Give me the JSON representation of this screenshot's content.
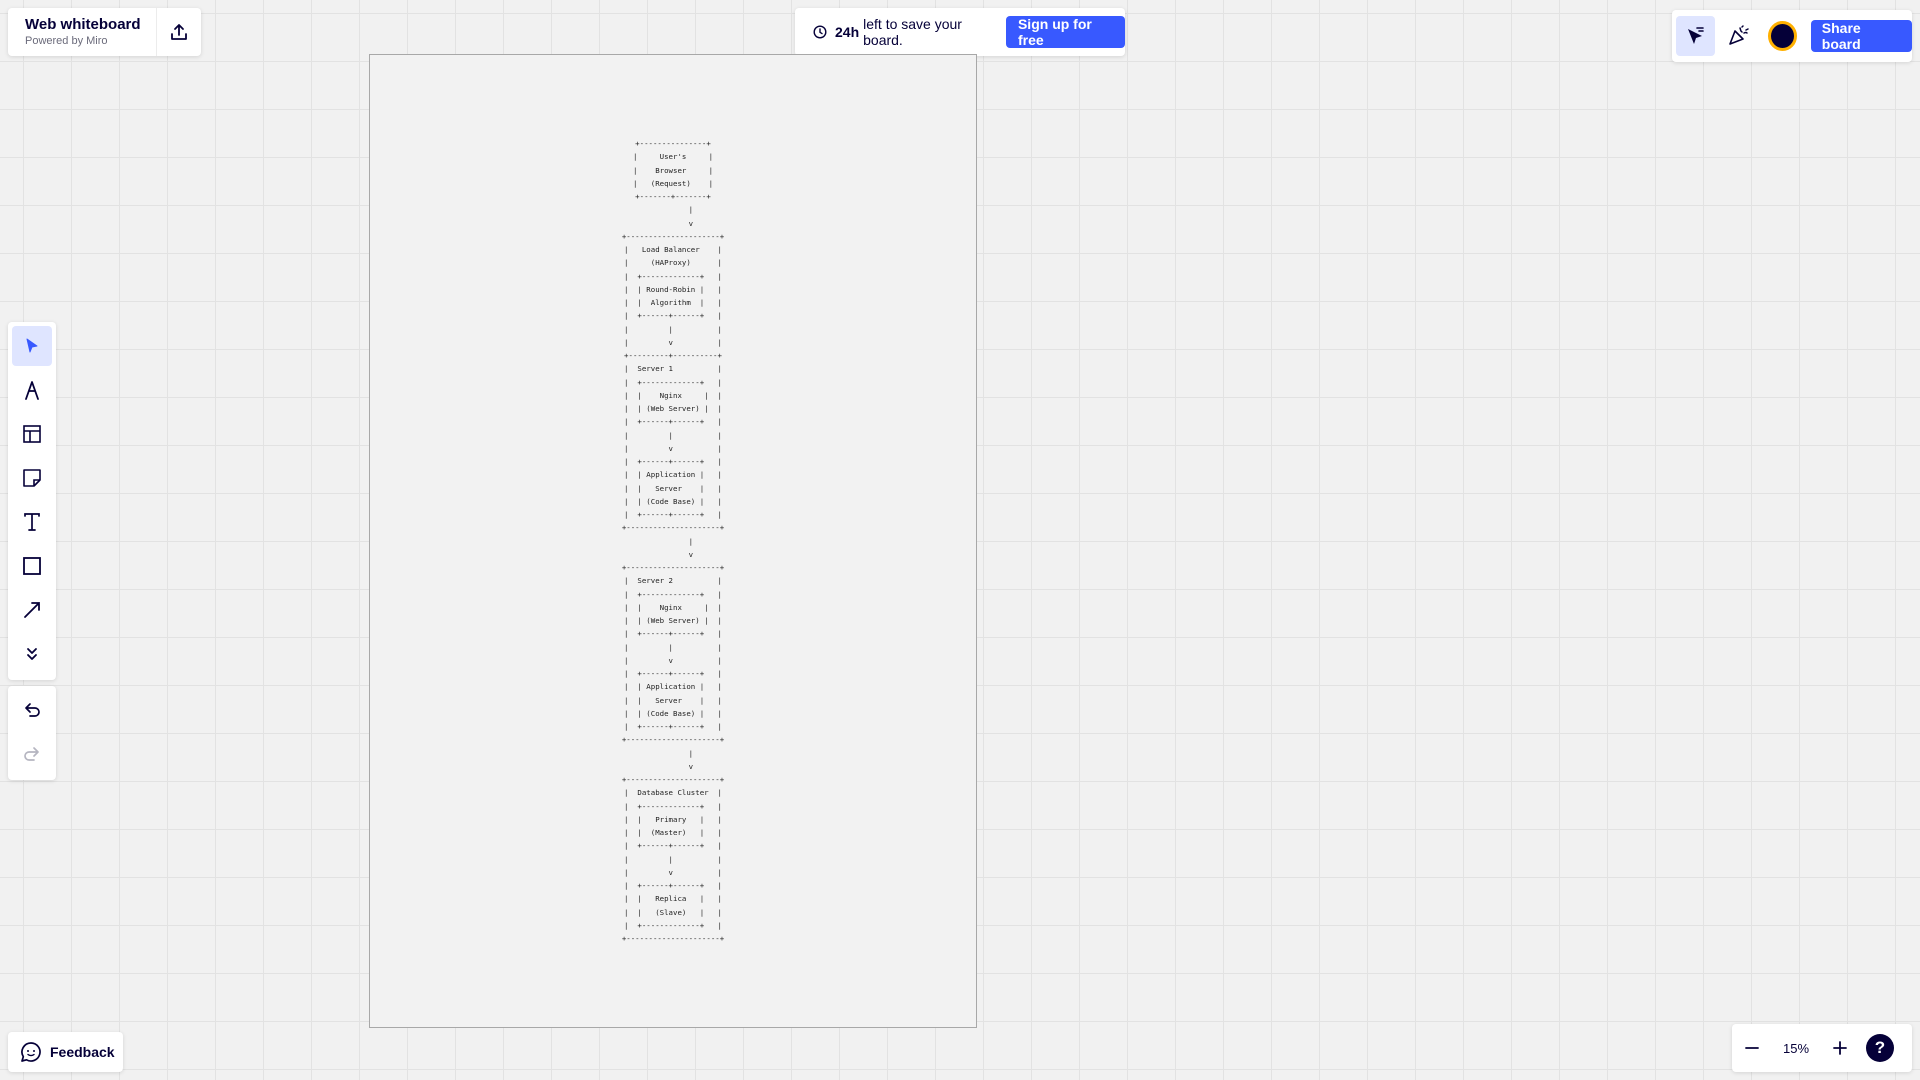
{
  "header": {
    "board_name": "Web whiteboard",
    "powered_by": "Powered by Miro",
    "export_icon": "upload-icon"
  },
  "banner": {
    "time_bold": "24h",
    "time_text": "left to save your board.",
    "signup_label": "Sign up for free",
    "clock_icon": "clock-icon"
  },
  "top_right": {
    "icons": [
      "cursor-flag-icon",
      "celebrate-icon"
    ],
    "share_label": "Share board"
  },
  "toolbar": {
    "tools": [
      "select-icon",
      "pen-icon",
      "templates-icon",
      "sticky-note-icon",
      "text-icon",
      "shape-icon",
      "connector-icon",
      "more-icon"
    ],
    "history": [
      "undo-icon",
      "redo-icon"
    ]
  },
  "frame": {
    "diagram_text": "+---------------+\n|     User's     |\n|    Browser     |\n|   (Request)    |\n+-------+-------+\n        |\n        v\n+---------------------+\n|   Load Balancer    |\n|     (HAProxy)      |\n|  +-------------+   |\n|  | Round-Robin |   |\n|  |  Algorithm  |   |\n|  +------+------+   |\n|         |          |\n|         v          |\n+---------+----------+\n|  Server 1          |\n|  +-------------+   |\n|  |    Nginx     |  |\n|  | (Web Server) |  |\n|  +------+------+   |\n|         |          |\n|         v          |\n|  +------+------+   |\n|  | Application |   |\n|  |   Server    |   |\n|  | (Code Base) |   |\n|  +------+------+   |\n+---------------------+\n        |\n        v\n+---------------------+\n|  Server 2          |\n|  +-------------+   |\n|  |    Nginx     |  |\n|  | (Web Server) |  |\n|  +------+------+   |\n|         |          |\n|         v          |\n|  +------+------+   |\n|  | Application |   |\n|  |   Server    |   |\n|  | (Code Base) |   |\n|  +------+------+   |\n+---------------------+\n        |\n        v\n+---------------------+\n|  Database Cluster  |\n|  +-------------+   |\n|  |   Primary   |   |\n|  |  (Master)   |   |\n|  +------+------+   |\n|         |          |\n|         v          |\n|  +------+------+   |\n|  |   Replica   |   |\n|  |   (Slave)   |   |\n|  +-------------+   |\n+---------------------+"
  },
  "footer": {
    "feedback_label": "Feedback",
    "zoom_level": "15%",
    "help_label": "?"
  },
  "colors": {
    "accent": "#3859ff",
    "text": "#050038",
    "canvas": "#f1f1f1"
  }
}
